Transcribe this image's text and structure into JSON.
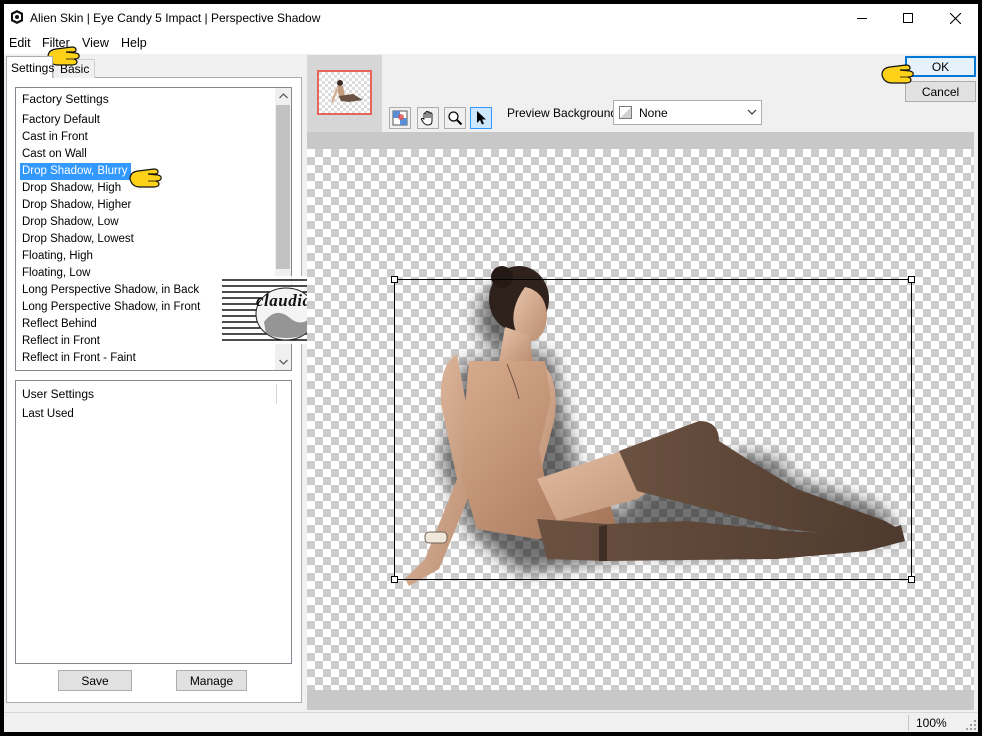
{
  "window": {
    "title": "Alien Skin | Eye Candy 5 Impact | Perspective Shadow",
    "controls": [
      "minimize-icon",
      "maximize-icon",
      "close-icon"
    ]
  },
  "menu": [
    "Edit",
    "Filter",
    "View",
    "Help"
  ],
  "tabs": {
    "settings": "Settings",
    "basic": "Basic",
    "active": "Settings"
  },
  "factory_settings": {
    "header": "Factory Settings",
    "items": [
      "Factory Default",
      "Cast in Front",
      "Cast on Wall",
      "Drop Shadow, Blurry",
      "Drop Shadow, High",
      "Drop Shadow, Higher",
      "Drop Shadow, Low",
      "Drop Shadow, Lowest",
      "Floating, High",
      "Floating, Low",
      "Long Perspective Shadow, in Back",
      "Long Perspective Shadow, in Front",
      "Reflect Behind",
      "Reflect in Front",
      "Reflect in Front - Faint"
    ],
    "selected": "Drop Shadow, Blurry"
  },
  "user_settings": {
    "header": "User Settings",
    "items": [
      "Last Used"
    ]
  },
  "buttons": {
    "save": "Save",
    "manage": "Manage",
    "ok": "OK",
    "cancel": "Cancel"
  },
  "preview": {
    "background_label": "Preview Background:",
    "background_value": "None",
    "tools": [
      "preview-background-tool-icon",
      "hand-tool-icon",
      "zoom-tool-icon",
      "pointer-tool-icon"
    ],
    "active_tool": "pointer"
  },
  "watermark": {
    "text": "claudia"
  },
  "status": {
    "zoom": "100%"
  },
  "colors": {
    "selection": "#3399ff",
    "ok_border": "#0078d7",
    "thumb_border": "#e8645a",
    "pointer_hand": "#ffd21a"
  }
}
